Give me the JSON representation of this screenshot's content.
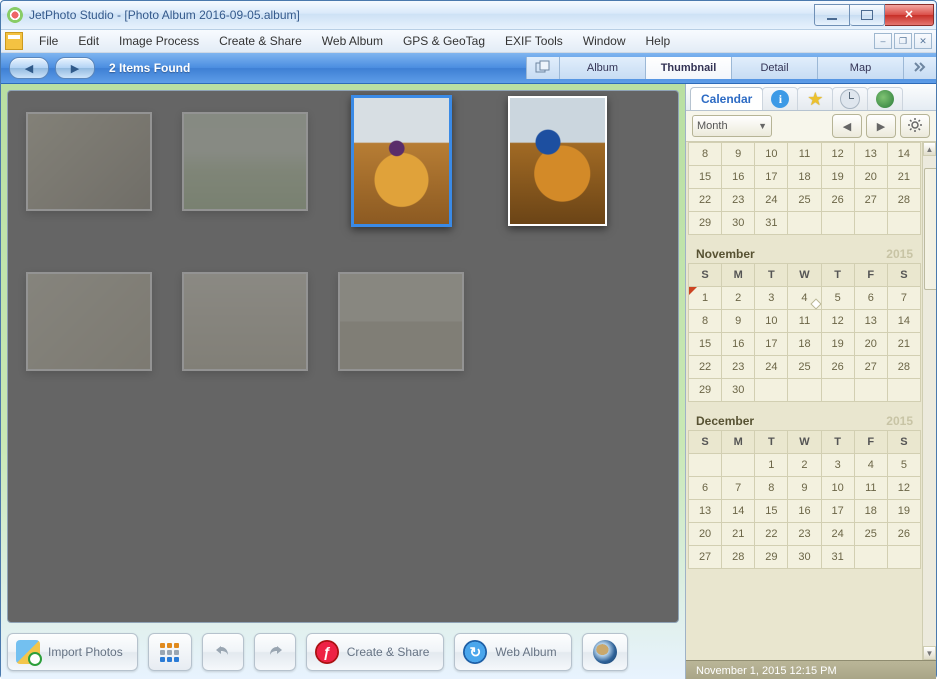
{
  "title": "JetPhoto Studio - [Photo Album 2016-09-05.album]",
  "menu": [
    "File",
    "Edit",
    "Image Process",
    "Create & Share",
    "Web Album",
    "GPS & GeoTag",
    "EXIF Tools",
    "Window",
    "Help"
  ],
  "toolbar": {
    "status": "2 Items Found",
    "views": [
      "Album",
      "Thumbnail",
      "Detail",
      "Map"
    ],
    "selected_view": "Thumbnail"
  },
  "actions": {
    "import": "Import Photos",
    "create_share": "Create & Share",
    "web_album": "Web Album"
  },
  "right": {
    "tab_label": "Calendar",
    "period_select": "Month",
    "status": "November 1, 2015 12:15 PM"
  },
  "dow": [
    "S",
    "M",
    "T",
    "W",
    "T",
    "F",
    "S"
  ],
  "months": [
    {
      "name": "",
      "year": "",
      "header": false,
      "weeks": [
        [
          8,
          9,
          10,
          11,
          12,
          13,
          14
        ],
        [
          15,
          16,
          17,
          18,
          19,
          20,
          21
        ],
        [
          22,
          23,
          24,
          25,
          26,
          27,
          28
        ],
        [
          29,
          30,
          31,
          null,
          null,
          null,
          null
        ]
      ],
      "today": null,
      "marks": []
    },
    {
      "name": "November",
      "year": "2015",
      "header": true,
      "weeks": [
        [
          1,
          2,
          3,
          4,
          5,
          6,
          7
        ],
        [
          8,
          9,
          10,
          11,
          12,
          13,
          14
        ],
        [
          15,
          16,
          17,
          18,
          19,
          20,
          21
        ],
        [
          22,
          23,
          24,
          25,
          26,
          27,
          28
        ],
        [
          29,
          30,
          null,
          null,
          null,
          null,
          null
        ]
      ],
      "today": 1,
      "marks": [
        4
      ]
    },
    {
      "name": "December",
      "year": "2015",
      "header": true,
      "weeks": [
        [
          null,
          null,
          1,
          2,
          3,
          4,
          5
        ],
        [
          6,
          7,
          8,
          9,
          10,
          11,
          12
        ],
        [
          13,
          14,
          15,
          16,
          17,
          18,
          19
        ],
        [
          20,
          21,
          22,
          23,
          24,
          25,
          26
        ],
        [
          27,
          28,
          29,
          30,
          31,
          null,
          null
        ]
      ],
      "today": null,
      "marks": []
    }
  ]
}
